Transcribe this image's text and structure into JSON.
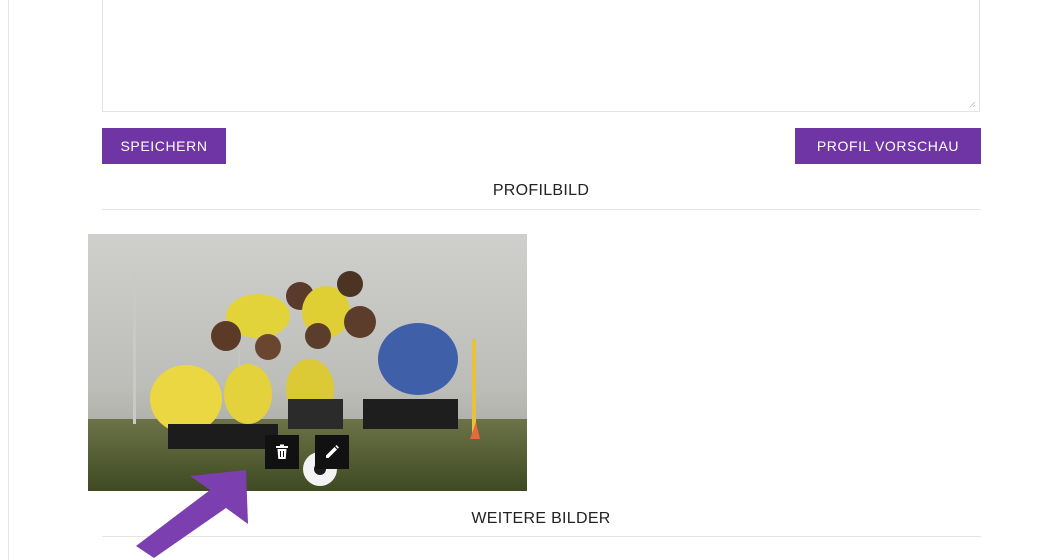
{
  "form": {
    "save_label": "SPEICHERN",
    "preview_label": "PROFIL VORSCHAU"
  },
  "sections": {
    "profile_picture_title": "PROFILBILD",
    "more_pictures_title": "WEITERE BILDER"
  },
  "profile_image": {
    "actions": [
      "trash-icon",
      "pencil-icon"
    ]
  },
  "colors": {
    "accent": "#6f35a5",
    "arrow": "#7b3fb0",
    "icon_button": "#111111"
  }
}
